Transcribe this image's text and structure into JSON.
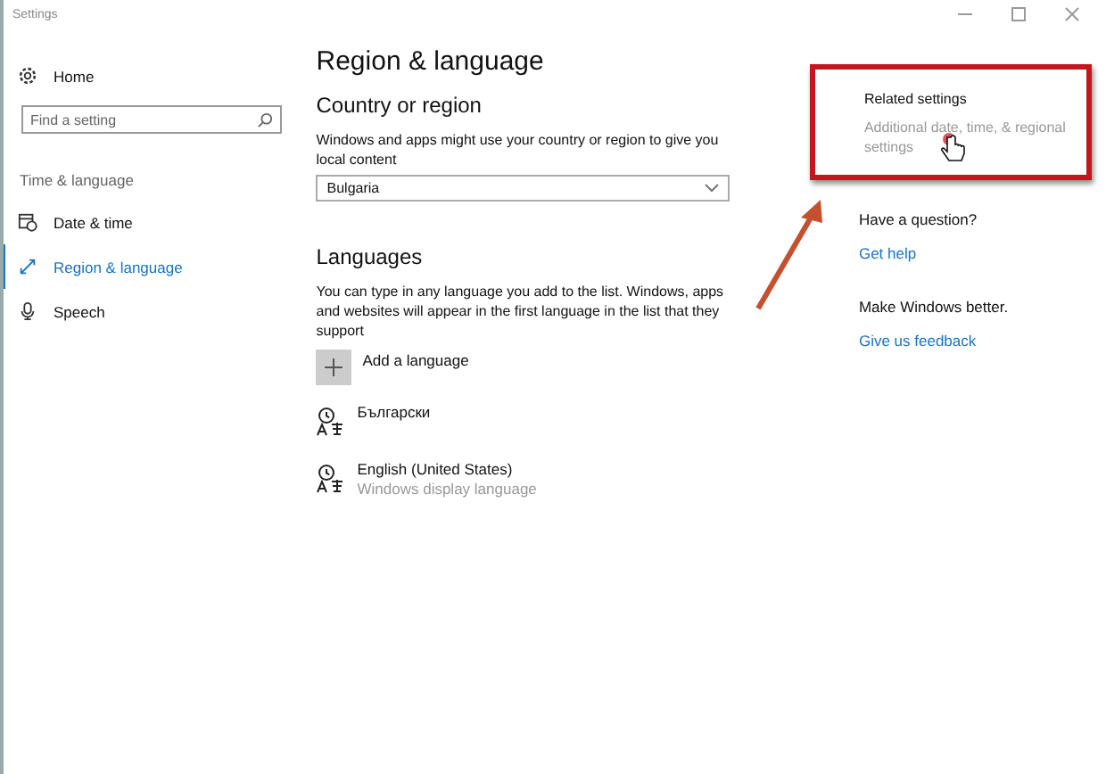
{
  "window": {
    "title": "Settings"
  },
  "sidebar": {
    "home": "Home",
    "search": {
      "placeholder": "Find a setting"
    },
    "section": "Time & language",
    "items": [
      {
        "kind": "date",
        "label": "Date & time",
        "selected": false
      },
      {
        "kind": "region",
        "label": "Region & language",
        "selected": true
      },
      {
        "kind": "speech",
        "label": "Speech",
        "selected": false
      }
    ]
  },
  "main": {
    "title": "Region & language",
    "country": {
      "heading": "Country or region",
      "description": "Windows and apps might use your country or region to give you local content",
      "value": "Bulgaria"
    },
    "languages": {
      "heading": "Languages",
      "description": "You can type in any language you add to the list. Windows, apps and websites will appear in the first language in the list that they support",
      "add": "Add a language",
      "items": [
        {
          "name": "Български"
        },
        {
          "name": "English (United States)",
          "subtitle": "Windows display language"
        }
      ]
    }
  },
  "related": {
    "heading": "Related settings",
    "link": "Additional date, time, & regional settings",
    "highlighted": true
  },
  "help": [
    {
      "heading": "Have a question?",
      "link": "Get help"
    },
    {
      "heading": "Make Windows better.",
      "link": "Give us feedback"
    }
  ]
}
